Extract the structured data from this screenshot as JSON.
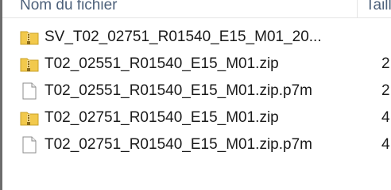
{
  "header": {
    "name_label": "Nom du fichier",
    "size_label": "Taille"
  },
  "files": [
    {
      "name": "SV_T02_02751_R01540_E15_M01_20...",
      "size": "",
      "icon": "zip-folder-icon"
    },
    {
      "name": "T02_02551_R01540_E15_M01.zip",
      "size": "2",
      "icon": "zip-folder-icon"
    },
    {
      "name": "T02_02551_R01540_E15_M01.zip.p7m",
      "size": "2",
      "icon": "blank-file-icon"
    },
    {
      "name": "T02_02751_R01540_E15_M01.zip",
      "size": "4",
      "icon": "zip-folder-icon"
    },
    {
      "name": "T02_02751_R01540_E15_M01.zip.p7m",
      "size": "4",
      "icon": "blank-file-icon"
    }
  ],
  "colors": {
    "zip_folder": "#f2c94c",
    "zip_zipper": "#8a6a1a",
    "header_text": "#4c607a"
  }
}
